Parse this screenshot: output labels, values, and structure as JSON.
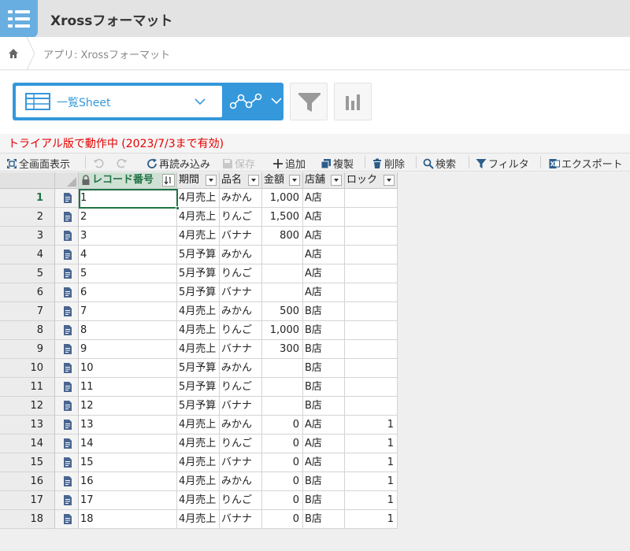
{
  "app": {
    "title": "Xrossフォーマット",
    "breadcrumb": "アプリ: Xrossフォーマット"
  },
  "view": {
    "selected": "一覧Sheet"
  },
  "trial_notice": "トライアル版で動作中 (2023/7/3まで有効)",
  "toolbar": {
    "fullscreen": "全画面表示",
    "reload": "再読み込み",
    "save": "保存",
    "add": "追加",
    "duplicate": "複製",
    "delete": "削除",
    "search": "検索",
    "filter": "フィルタ",
    "export": "エクスポート"
  },
  "columns": {
    "record_no": "レコード番号",
    "period": "期間",
    "product": "品名",
    "amount": "金額",
    "store": "店舗",
    "lock": "ロック"
  },
  "rows": [
    {
      "n": "1",
      "rec": "1",
      "period": "4月売上",
      "product": "みかん",
      "amount": "1,000",
      "store": "A店",
      "lock": ""
    },
    {
      "n": "2",
      "rec": "2",
      "period": "4月売上",
      "product": "りんご",
      "amount": "1,500",
      "store": "A店",
      "lock": ""
    },
    {
      "n": "3",
      "rec": "3",
      "period": "4月売上",
      "product": "バナナ",
      "amount": "800",
      "store": "A店",
      "lock": ""
    },
    {
      "n": "4",
      "rec": "4",
      "period": "5月予算",
      "product": "みかん",
      "amount": "",
      "store": "A店",
      "lock": ""
    },
    {
      "n": "5",
      "rec": "5",
      "period": "5月予算",
      "product": "りんご",
      "amount": "",
      "store": "A店",
      "lock": ""
    },
    {
      "n": "6",
      "rec": "6",
      "period": "5月予算",
      "product": "バナナ",
      "amount": "",
      "store": "A店",
      "lock": ""
    },
    {
      "n": "7",
      "rec": "7",
      "period": "4月売上",
      "product": "みかん",
      "amount": "500",
      "store": "B店",
      "lock": ""
    },
    {
      "n": "8",
      "rec": "8",
      "period": "4月売上",
      "product": "りんご",
      "amount": "1,000",
      "store": "B店",
      "lock": ""
    },
    {
      "n": "9",
      "rec": "9",
      "period": "4月売上",
      "product": "バナナ",
      "amount": "300",
      "store": "B店",
      "lock": ""
    },
    {
      "n": "10",
      "rec": "10",
      "period": "5月予算",
      "product": "みかん",
      "amount": "",
      "store": "B店",
      "lock": ""
    },
    {
      "n": "11",
      "rec": "11",
      "period": "5月予算",
      "product": "りんご",
      "amount": "",
      "store": "B店",
      "lock": ""
    },
    {
      "n": "12",
      "rec": "12",
      "period": "5月予算",
      "product": "バナナ",
      "amount": "",
      "store": "B店",
      "lock": ""
    },
    {
      "n": "13",
      "rec": "13",
      "period": "4月売上",
      "product": "みかん",
      "amount": "0",
      "store": "A店",
      "lock": "1"
    },
    {
      "n": "14",
      "rec": "14",
      "period": "4月売上",
      "product": "りんご",
      "amount": "0",
      "store": "A店",
      "lock": "1"
    },
    {
      "n": "15",
      "rec": "15",
      "period": "4月売上",
      "product": "バナナ",
      "amount": "0",
      "store": "A店",
      "lock": "1"
    },
    {
      "n": "16",
      "rec": "16",
      "period": "4月売上",
      "product": "みかん",
      "amount": "0",
      "store": "B店",
      "lock": "1"
    },
    {
      "n": "17",
      "rec": "17",
      "period": "4月売上",
      "product": "りんご",
      "amount": "0",
      "store": "B店",
      "lock": "1"
    },
    {
      "n": "18",
      "rec": "18",
      "period": "4月売上",
      "product": "バナナ",
      "amount": "0",
      "store": "B店",
      "lock": "1"
    }
  ],
  "colors": {
    "accent": "#3498db",
    "app_icon": "#69aee0",
    "trial_text": "#e60000",
    "selected_row_number": "#217346"
  }
}
